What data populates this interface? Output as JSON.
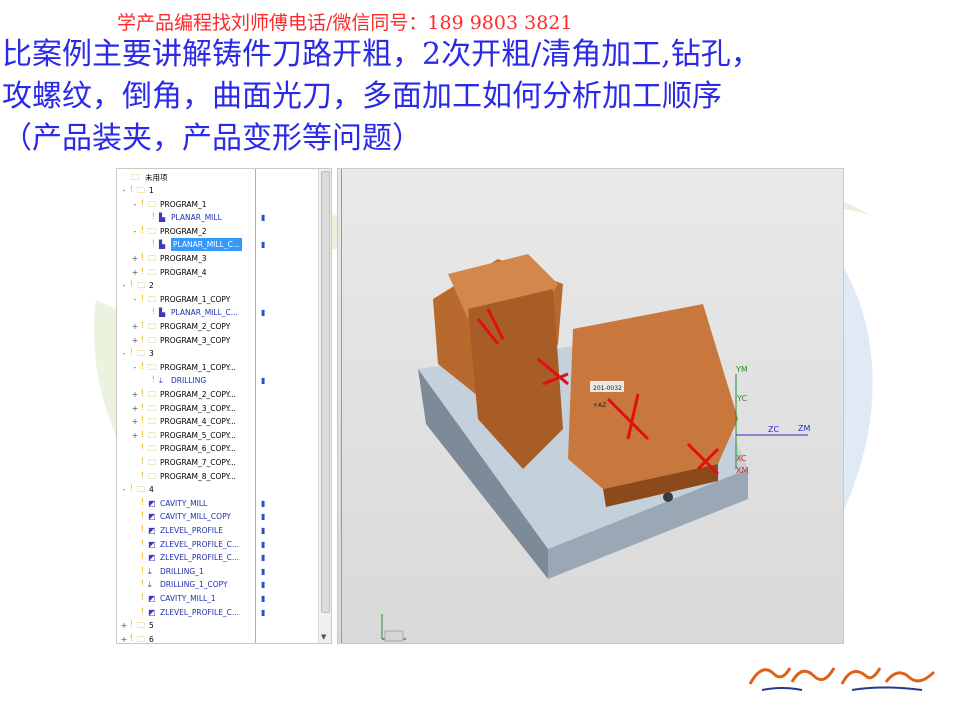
{
  "header": {
    "contact": "学产品编程找刘师傅电话/微信同号：189 9803 3821",
    "lines": [
      "比案例主要讲解铸件刀路开粗，2次开粗/清角加工,钻孔，",
      "攻螺纹，倒角，曲面光刀，多面加工如何分析加工顺序",
      "（产品装夹，产品变形等问题）"
    ]
  },
  "navigator": {
    "unused_label": "未用项",
    "rows": [
      {
        "label": "1",
        "expander": "-",
        "key": true,
        "icon": "folder",
        "indent": 0
      },
      {
        "label": "PROGRAM_1",
        "expander": "-",
        "key": true,
        "icon": "folder",
        "indent": 1
      },
      {
        "label": "PLANAR_MILL",
        "expander": "",
        "key": true,
        "icon": "op",
        "indent": 2,
        "path": true,
        "blue": true
      },
      {
        "label": "PROGRAM_2",
        "expander": "-",
        "key": true,
        "icon": "folder",
        "indent": 1
      },
      {
        "label": "PLANAR_MILL_C...",
        "expander": "",
        "key": true,
        "icon": "op",
        "indent": 2,
        "path": true,
        "selected": true
      },
      {
        "label": "PROGRAM_3",
        "expander": "+",
        "key": true,
        "icon": "folder",
        "indent": 1
      },
      {
        "label": "PROGRAM_4",
        "expander": "+",
        "key": true,
        "icon": "folder",
        "indent": 1
      },
      {
        "label": "2",
        "expander": "-",
        "key": true,
        "icon": "folder",
        "indent": 0
      },
      {
        "label": "PROGRAM_1_COPY",
        "expander": "-",
        "key": true,
        "icon": "folder",
        "indent": 1
      },
      {
        "label": "PLANAR_MILL_C...",
        "expander": "",
        "key": true,
        "icon": "op",
        "indent": 2,
        "path": true,
        "blue": true
      },
      {
        "label": "PROGRAM_2_COPY",
        "expander": "+",
        "key": true,
        "icon": "folder",
        "indent": 1
      },
      {
        "label": "PROGRAM_3_COPY",
        "expander": "+",
        "key": true,
        "icon": "folder",
        "indent": 1
      },
      {
        "label": "3",
        "expander": "-",
        "key": true,
        "icon": "folder",
        "indent": 0
      },
      {
        "label": "PROGRAM_1_COPY...",
        "expander": "-",
        "key": true,
        "icon": "folder",
        "indent": 1
      },
      {
        "label": "DRILLING",
        "expander": "",
        "key": true,
        "icon": "drill",
        "indent": 2,
        "path": true,
        "blue": true
      },
      {
        "label": "PROGRAM_2_COPY...",
        "expander": "+",
        "key": true,
        "icon": "folder",
        "indent": 1
      },
      {
        "label": "PROGRAM_3_COPY...",
        "expander": "+",
        "key": true,
        "icon": "folder",
        "indent": 1
      },
      {
        "label": "PROGRAM_4_COPY...",
        "expander": "+",
        "key": true,
        "icon": "folder",
        "indent": 1
      },
      {
        "label": "PROGRAM_5_COPY...",
        "expander": "+",
        "key": true,
        "icon": "folder",
        "indent": 1
      },
      {
        "label": "PROGRAM_6_COPY...",
        "expander": "",
        "key": true,
        "icon": "folder",
        "indent": 1
      },
      {
        "label": "PROGRAM_7_COPY...",
        "expander": "",
        "key": true,
        "icon": "folder",
        "indent": 1
      },
      {
        "label": "PROGRAM_8_COPY...",
        "expander": "",
        "key": true,
        "icon": "folder",
        "indent": 1
      },
      {
        "label": "4",
        "expander": "-",
        "key": true,
        "icon": "folder",
        "indent": 0
      },
      {
        "label": "CAVITY_MILL",
        "expander": "",
        "key": true,
        "icon": "cavity",
        "indent": 1,
        "path": true,
        "blue": true
      },
      {
        "label": "CAVITY_MILL_COPY",
        "expander": "",
        "key": true,
        "icon": "cavity",
        "indent": 1,
        "path": true,
        "blue": true
      },
      {
        "label": "ZLEVEL_PROFILE",
        "expander": "",
        "key": true,
        "icon": "zlevel",
        "indent": 1,
        "path": true,
        "blue": true
      },
      {
        "label": "ZLEVEL_PROFILE_C...",
        "expander": "",
        "key": true,
        "icon": "zlevel",
        "indent": 1,
        "path": true,
        "blue": true
      },
      {
        "label": "ZLEVEL_PROFILE_C...",
        "expander": "",
        "key": true,
        "icon": "zlevel",
        "indent": 1,
        "path": true,
        "blue": true
      },
      {
        "label": "DRILLING_1",
        "expander": "",
        "key": true,
        "icon": "drill",
        "indent": 1,
        "path": true,
        "blue": true
      },
      {
        "label": "DRILLING_1_COPY",
        "expander": "",
        "key": true,
        "icon": "drill",
        "indent": 1,
        "path": true,
        "blue": true
      },
      {
        "label": "CAVITY_MILL_1",
        "expander": "",
        "key": true,
        "icon": "cavity",
        "indent": 1,
        "path": true,
        "blue": true
      },
      {
        "label": "ZLEVEL_PROFILE_C...",
        "expander": "",
        "key": true,
        "icon": "zlevel",
        "indent": 1,
        "path": true,
        "blue": true
      },
      {
        "label": "5",
        "expander": "+",
        "key": true,
        "icon": "folder",
        "indent": 0
      },
      {
        "label": "6",
        "expander": "+",
        "key": true,
        "icon": "folder",
        "indent": 0
      }
    ]
  },
  "viewport": {
    "part_label": "201-0032",
    "part_label2": "+AZ",
    "axes": {
      "ym": "YM",
      "yc": "YC",
      "zc": "ZC",
      "zm": "ZM",
      "xc": "XC",
      "xm": "XM"
    }
  },
  "colors": {
    "part": "#c8783c",
    "fixture": "#b8c6d6",
    "title": "#2a2ae8",
    "contact": "#ff2a2a"
  }
}
